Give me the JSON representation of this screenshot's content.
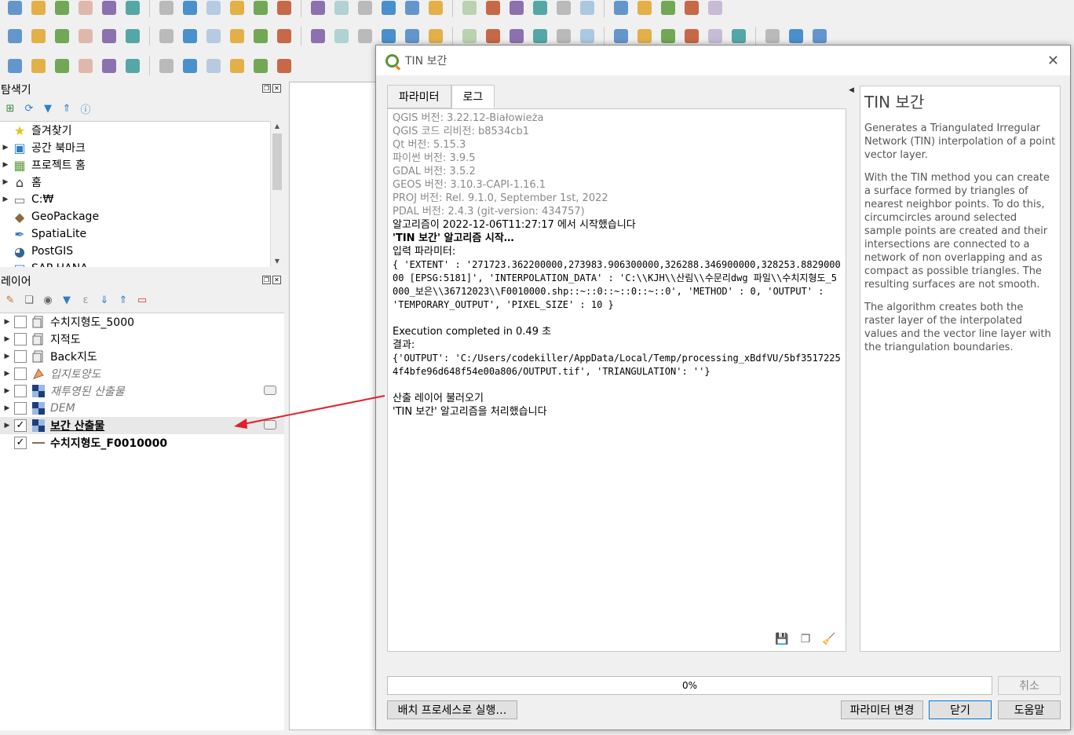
{
  "toolbar": {
    "row1_icons": [
      "new-project-icon",
      "open-project-icon",
      "save-project-icon",
      "new-print-layout-icon",
      "layout-manager-icon",
      "style-manager-icon",
      "pan-icon",
      "pan-to-selection-icon",
      "zoom-in-icon",
      "zoom-out-icon",
      "zoom-full-icon",
      "zoom-to-selection-icon",
      "zoom-to-layer-icon",
      "zoom-last-icon",
      "zoom-next-icon",
      "new-bookmark-icon",
      "show-bookmarks-icon",
      "temporal-controller-icon",
      "refresh-icon",
      "select-features-icon",
      "deselect-icon",
      "identify-icon",
      "measure-icon",
      "attribute-table-icon",
      "processing-toolbox-icon",
      "statistics-icon",
      "map-tips-icon",
      "annotation-icon",
      "locator-icon"
    ],
    "row2_icons": [
      "add-vector-layer-icon",
      "add-raster-layer-icon",
      "add-delimited-text-icon",
      "add-virtual-layer-icon",
      "add-wms-layer-icon",
      "add-mesh-layer-icon",
      "data-source-manager-icon",
      "digitize-icon",
      "pencil-icon",
      "save-edits-icon",
      "add-feature-icon",
      "vertex-tool-icon",
      "modify-attributes-icon",
      "delete-icon",
      "cut-icon",
      "copy-icon",
      "paste-icon",
      "undo-icon",
      "redo-icon",
      "label-icon",
      "label-pin-icon",
      "label-abc-icon",
      "label-abc-red-icon",
      "label-show-icon",
      "label-move-icon",
      "label-rotate-icon",
      "label-change-icon",
      "wms-globe-icon",
      "wms-search-icon",
      "metasearch-icon",
      "python-icon",
      "help-icon",
      "crosshair-icon"
    ],
    "row3_icons": [
      "vector-tools-icon",
      "field-calculator-icon",
      "digitizing-icon",
      "advanced-digitizing-icon",
      "snapping-icon",
      "topology-icon",
      "text-annotation-icon",
      "select-tool-icon",
      "polygon-tool-icon",
      "node-tool-icon",
      "star-tool-icon",
      "text-tool-icon"
    ]
  },
  "browser_panel": {
    "title": "탐색기",
    "items": [
      {
        "label": "즐겨찾기",
        "icon": "star-icon",
        "expandable": false
      },
      {
        "label": "공간 북마크",
        "icon": "bookmark-icon",
        "expandable": true
      },
      {
        "label": "프로젝트 홈",
        "icon": "project-home-icon",
        "expandable": true
      },
      {
        "label": "홈",
        "icon": "home-icon",
        "expandable": true
      },
      {
        "label": "C:₩",
        "icon": "drive-icon",
        "expandable": true
      },
      {
        "label": "GeoPackage",
        "icon": "geopackage-icon",
        "expandable": false
      },
      {
        "label": "SpatiaLite",
        "icon": "spatialite-icon",
        "expandable": false
      },
      {
        "label": "PostGIS",
        "icon": "postgis-icon",
        "expandable": false
      },
      {
        "label": "SAP HANA",
        "icon": "sap-hana-icon",
        "expandable": false
      }
    ]
  },
  "layers_panel": {
    "title": "레이어",
    "layers": [
      {
        "label": "수치지형도_5000",
        "checked": false,
        "style": "normal",
        "icon": "group-icon",
        "expandable": true
      },
      {
        "label": "지적도",
        "checked": false,
        "style": "normal",
        "icon": "group-icon",
        "expandable": true
      },
      {
        "label": "Back지도",
        "checked": false,
        "style": "normal",
        "icon": "group-icon",
        "expandable": true
      },
      {
        "label": "입지토양도",
        "checked": false,
        "style": "italic",
        "icon": "vector-polygon-icon",
        "expandable": true
      },
      {
        "label": "재투영된 산출물",
        "checked": false,
        "style": "italic",
        "icon": "raster-icon",
        "expandable": true,
        "indicator": true
      },
      {
        "label": "DEM",
        "checked": false,
        "style": "italic",
        "icon": "raster-icon",
        "expandable": true
      },
      {
        "label": "보간 산출물",
        "checked": true,
        "style": "bold-underline",
        "icon": "raster-icon",
        "expandable": true,
        "indicator": true,
        "selected": true
      },
      {
        "label": "수치지형도_F0010000",
        "checked": true,
        "style": "bold",
        "icon": "line-layer-icon",
        "expandable": false
      }
    ]
  },
  "dialog": {
    "title": "TIN 보간",
    "tabs": [
      "파라미터",
      "로그"
    ],
    "active_tab": "로그",
    "log_lines": [
      {
        "text": "QGIS 버전: 3.22.12-Białowieża",
        "style": "gray"
      },
      {
        "text": "QGIS 코드 리비전: b8534cb1",
        "style": "gray"
      },
      {
        "text": "Qt 버전: 5.15.3",
        "style": "gray"
      },
      {
        "text": "파이썬 버전: 3.9.5",
        "style": "gray"
      },
      {
        "text": "GDAL 버전: 3.5.2",
        "style": "gray"
      },
      {
        "text": "GEOS 버전: 3.10.3-CAPI-1.16.1",
        "style": "gray"
      },
      {
        "text": "PROJ 버전: Rel. 9.1.0, September 1st, 2022",
        "style": "gray"
      },
      {
        "text": "PDAL 버전: 2.4.3 (git-version: 434757)",
        "style": "gray"
      },
      {
        "text": "알고리즘이 2022-12-06T11:27:17 에서 시작했습니다",
        "style": "normal"
      },
      {
        "text": "'TIN 보간' 알고리즘 시작…",
        "style": "bold"
      },
      {
        "text": "입력 파라미터:",
        "style": "normal"
      },
      {
        "text": "{ 'EXTENT' : '271723.362200000,273983.906300000,326288.346900000,328253.882900000 [EPSG:5181]', 'INTERPOLATION_DATA' : 'C:\\\\KJH\\\\산림\\\\수문리dwg 파일\\\\수치지형도_5000_보은\\\\36712023\\\\F0010000.shp::~::0::~::0::~::0', 'METHOD' : 0, 'OUTPUT' : 'TEMPORARY_OUTPUT', 'PIXEL_SIZE' : 10 }",
        "style": "mono"
      },
      {
        "text": "",
        "style": "gap"
      },
      {
        "text": "Execution completed in 0.49 초",
        "style": "normal"
      },
      {
        "text": "결과:",
        "style": "normal"
      },
      {
        "text": "{'OUTPUT': 'C:/Users/codekiller/AppData/Local/Temp/processing_xBdfVU/5bf35172254f4bfe96d648f54e00a806/OUTPUT.tif', 'TRIANGULATION': ''}",
        "style": "mono"
      },
      {
        "text": "",
        "style": "gap"
      },
      {
        "text": "산출 레이어 불러오기",
        "style": "normal"
      },
      {
        "text": "'TIN 보간' 알고리즘을 처리했습니다",
        "style": "normal"
      }
    ],
    "help": {
      "title": "TIN 보간",
      "paragraphs": [
        "Generates a Triangulated Irregular Network (TIN) interpolation of a point vector layer.",
        "With the TIN method you can create a surface formed by triangles of nearest neighbor points. To do this, circumcircles around selected sample points are created and their intersections are connected to a network of non overlapping and as compact as possible triangles. The resulting surfaces are not smooth.",
        "The algorithm creates both the raster layer of the interpolated values and the vector line layer with the triangulation boundaries."
      ]
    },
    "progress": {
      "value": 0,
      "label": "0%"
    },
    "buttons": {
      "cancel": "취소",
      "batch": "배치 프로세스로 실행…",
      "change_params": "파라미터 변경",
      "close": "닫기",
      "help": "도움말"
    }
  },
  "colors": {
    "accent_green": "#589632",
    "annotation_arrow": "#e0202a",
    "button_default_border": "#0078d7"
  }
}
